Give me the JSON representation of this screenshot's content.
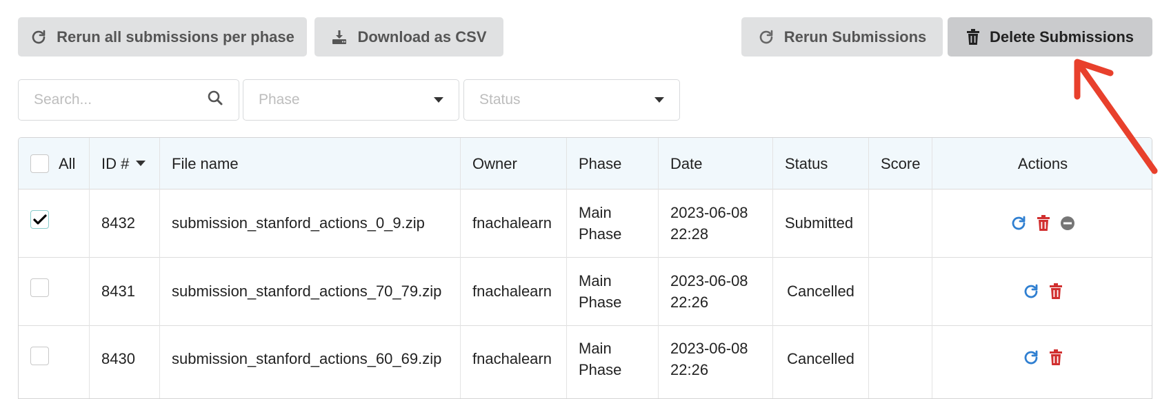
{
  "toolbar": {
    "rerun_all_label": "Rerun all submissions per phase",
    "download_csv_label": "Download as CSV",
    "rerun_submissions_label": "Rerun Submissions",
    "delete_submissions_label": "Delete Submissions"
  },
  "filters": {
    "search_placeholder": "Search...",
    "phase_placeholder": "Phase",
    "status_placeholder": "Status"
  },
  "table": {
    "headers": {
      "select_all": "All",
      "id": "ID #",
      "file_name": "File name",
      "owner": "Owner",
      "phase": "Phase",
      "date": "Date",
      "status": "Status",
      "score": "Score",
      "actions": "Actions"
    },
    "rows": [
      {
        "checked": true,
        "id": "8432",
        "file_name": "submission_stanford_actions_0_9.zip",
        "owner": "fnachalearn",
        "phase_line1": "Main",
        "phase_line2": "Phase",
        "date_line1": "2023-06-08",
        "date_line2": "22:28",
        "status": "Submitted",
        "score": "",
        "actions": [
          "rerun-icon",
          "delete-icon",
          "cancel-icon"
        ]
      },
      {
        "checked": false,
        "id": "8431",
        "file_name": "submission_stanford_actions_70_79.zip",
        "owner": "fnachalearn",
        "phase_line1": "Main",
        "phase_line2": "Phase",
        "date_line1": "2023-06-08",
        "date_line2": "22:26",
        "status": "Cancelled",
        "score": "",
        "actions": [
          "rerun-icon",
          "delete-icon"
        ]
      },
      {
        "checked": false,
        "id": "8430",
        "file_name": "submission_stanford_actions_60_69.zip",
        "owner": "fnachalearn",
        "phase_line1": "Main",
        "phase_line2": "Phase",
        "date_line1": "2023-06-08",
        "date_line2": "22:26",
        "status": "Cancelled",
        "score": "",
        "actions": [
          "rerun-icon",
          "delete-icon"
        ]
      }
    ]
  },
  "colors": {
    "rerun_icon": "#2f7fd1",
    "delete_icon": "#d12f2f",
    "cancel_icon": "#767676",
    "annotation_arrow": "#e8402c"
  }
}
